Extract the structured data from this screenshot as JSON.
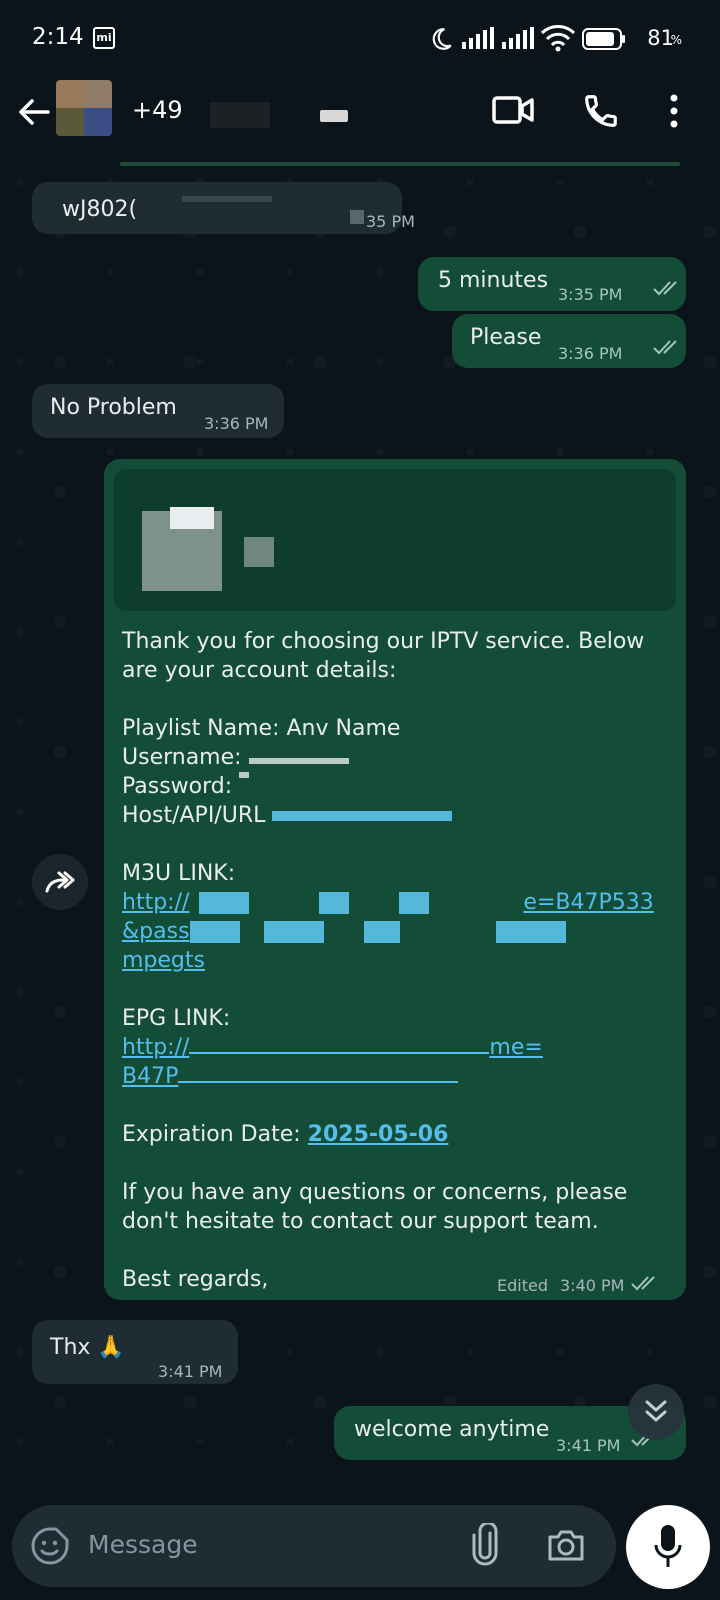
{
  "status_bar": {
    "time": "2:14",
    "battery_percent": "81",
    "battery_sign": "%"
  },
  "header": {
    "contact_name": "+49",
    "icons": [
      "back-arrow-icon",
      "video-call-icon",
      "phone-icon",
      "more-vert-icon"
    ]
  },
  "messages": [
    {
      "direction": "in",
      "text": "wJ802(",
      "time": "35 PM"
    },
    {
      "direction": "out",
      "text": "5 minutes",
      "time": "3:35 PM"
    },
    {
      "direction": "out",
      "text": "Please",
      "time": "3:36 PM"
    },
    {
      "direction": "in",
      "text": "No Problem",
      "time": "3:36 PM"
    },
    {
      "direction": "out",
      "time": "3:40 PM",
      "edited_label": "Edited",
      "intro": "Thank you for choosing our IPTV service. Below are your account details:",
      "playlist": "Playlist Name: Anv Name",
      "username": "Username:",
      "password": "Password:",
      "host": "Host/API/URL",
      "m3u_label": "M3U LINK:",
      "m3u_line1_start": "http://",
      "m3u_line1_end": "e=B47P533",
      "m3u_line2_start": "&pass",
      "m3u_line3": "mpegts",
      "epg_label": "EPG LINK:",
      "epg_line1_start": "http://",
      "epg_line1_end": "me=",
      "epg_line2_start": "B47P",
      "expiration_label": "Expiration Date:",
      "expiration_date": "2025-05-06",
      "closing": "If you have any questions or concerns, please don't hesitate to contact our support team.",
      "regards": "Best regards,"
    },
    {
      "direction": "in",
      "text": "Thx 🙏",
      "time": "3:41 PM"
    },
    {
      "direction": "out",
      "text": "welcome anytime",
      "time": "3:41 PM"
    }
  ],
  "input": {
    "placeholder": "Message"
  }
}
